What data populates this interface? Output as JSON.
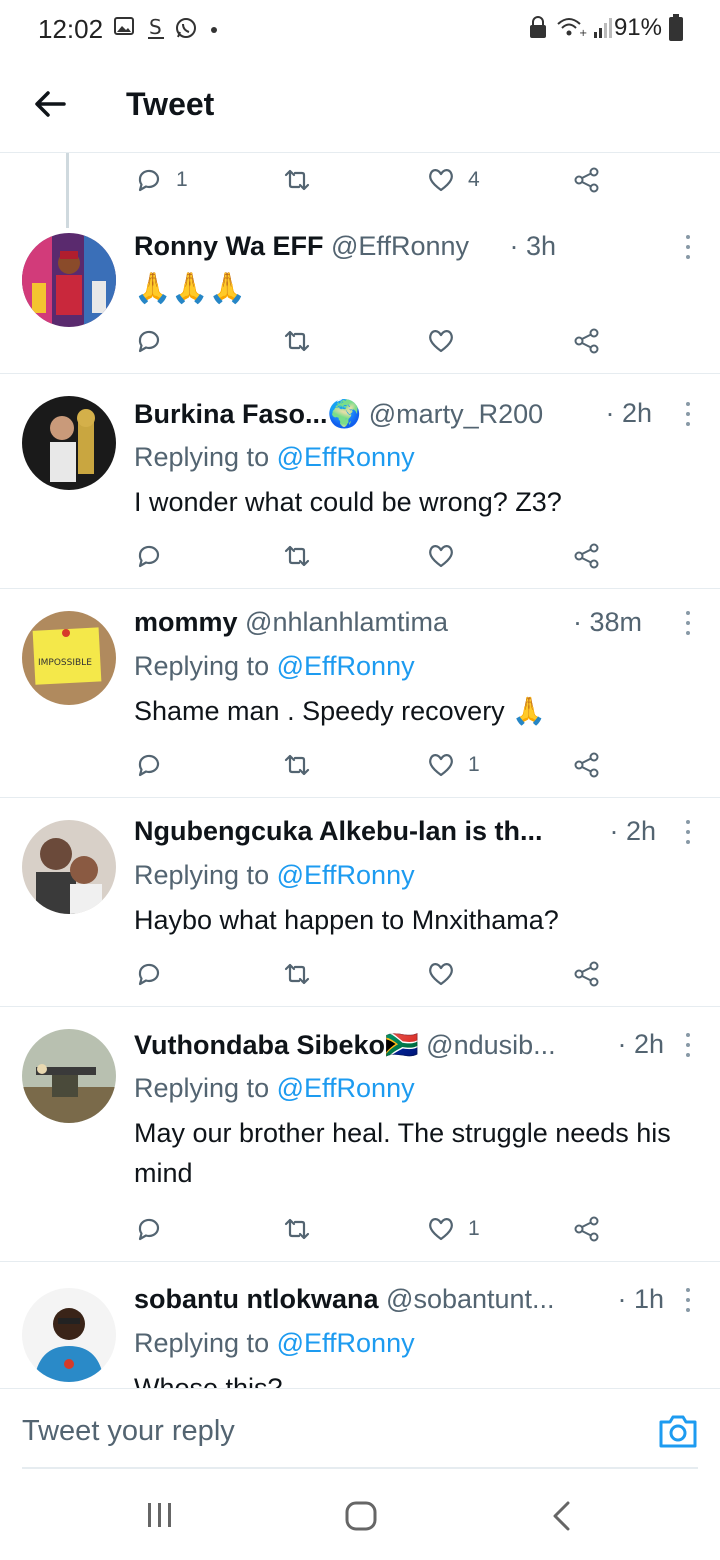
{
  "status_bar": {
    "time": "12:02",
    "battery": "91%"
  },
  "header": {
    "title": "Tweet"
  },
  "parent_tweet_actions": {
    "reply_count": "1",
    "retweet_count": "",
    "like_count": "4"
  },
  "tweets": [
    {
      "name": "Ronny Wa EFF",
      "handle": "@EffRonny",
      "time": "· 3h",
      "body": "🙏🙏🙏",
      "replying_to": "",
      "reply_count": "",
      "like_count": ""
    },
    {
      "name": "Burkina Faso...🌍",
      "handle": "@marty_R200",
      "time": "· 2h",
      "replying_label": "Replying to",
      "replying_to": "@EffRonny",
      "body": "I wonder what could be wrong? Z3?",
      "reply_count": "",
      "like_count": ""
    },
    {
      "name": "mommy",
      "handle": "@nhlanhlamtima",
      "time": "· 38m",
      "replying_label": "Replying to",
      "replying_to": "@EffRonny",
      "body": "Shame man . Speedy recovery 🙏",
      "reply_count": "",
      "like_count": "1",
      "avatar_text": "IMPOSSIBLE"
    },
    {
      "name": "Ngubengcuka Alkebu-lan is th...",
      "handle": "",
      "time": "· 2h",
      "replying_label": "Replying to",
      "replying_to": "@EffRonny",
      "body": "Haybo what happen to Mnxithama?",
      "reply_count": "",
      "like_count": ""
    },
    {
      "name": "Vuthondaba Sibeko🇿🇦",
      "handle": "@ndusib...",
      "time": "· 2h",
      "replying_label": "Replying to",
      "replying_to": "@EffRonny",
      "body": "May our brother heal. The struggle needs his mind",
      "reply_count": "",
      "like_count": "1"
    },
    {
      "name": "sobantu ntlokwana",
      "handle": "@sobantunt...",
      "time": "· 1h",
      "replying_label": "Replying to",
      "replying_to": "@EffRonny",
      "body": "Whose this?",
      "reply_count": "",
      "like_count": ""
    }
  ],
  "reply_bar": {
    "placeholder": "Tweet your reply"
  },
  "colors": {
    "accent": "#1d9bf0",
    "secondary_text": "#536471",
    "divider": "#e6ecf0"
  }
}
